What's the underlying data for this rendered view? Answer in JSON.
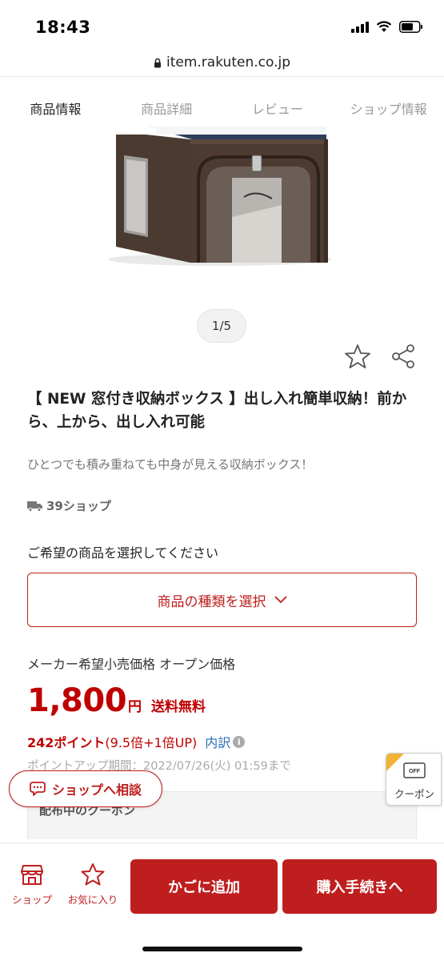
{
  "status_bar": {
    "time": "18:43"
  },
  "browser": {
    "url": "item.rakuten.co.jp"
  },
  "tabs": [
    {
      "label": "商品情報",
      "active": true
    },
    {
      "label": "商品詳細",
      "active": false
    },
    {
      "label": "レビュー",
      "active": false
    },
    {
      "label": "ショップ情報",
      "active": false
    }
  ],
  "gallery": {
    "pager": "1/5"
  },
  "product": {
    "title": "【 NEW 窓付き収納ボックス 】出し入れ簡単収納！前から、上から、出し入れ可能",
    "subtitle": "ひとつでも積み重ねても中身が見える収納ボックス！",
    "shop_label": "39ショップ"
  },
  "selection": {
    "prompt": "ご希望の商品を選択してください",
    "button_label": "商品の種類を選択"
  },
  "pricing": {
    "maker_price": "メーカー希望小売価格 オープン価格",
    "price": "1,800",
    "currency": "円",
    "shipping": "送料無料",
    "points": "242ポイント",
    "points_detail": "(9.5倍+1倍UP)",
    "breakdown_label": "内訳",
    "point_period": "ポイントアップ期間：2022/07/26(火) 01:59まで"
  },
  "coupon": {
    "section_title": "配布中のクーポン",
    "tab_label": "クーポン",
    "tab_badge": "OFF"
  },
  "consult": {
    "label": "ショップへ相談"
  },
  "bottom_bar": {
    "shop_label": "ショップ",
    "favorite_label": "お気に入り",
    "cart_label": "かごに追加",
    "buy_label": "購入手続きへ"
  },
  "colors": {
    "brand_red": "#bf1e1e",
    "price_red": "#bf0000",
    "link_blue": "#2b6fb6"
  }
}
